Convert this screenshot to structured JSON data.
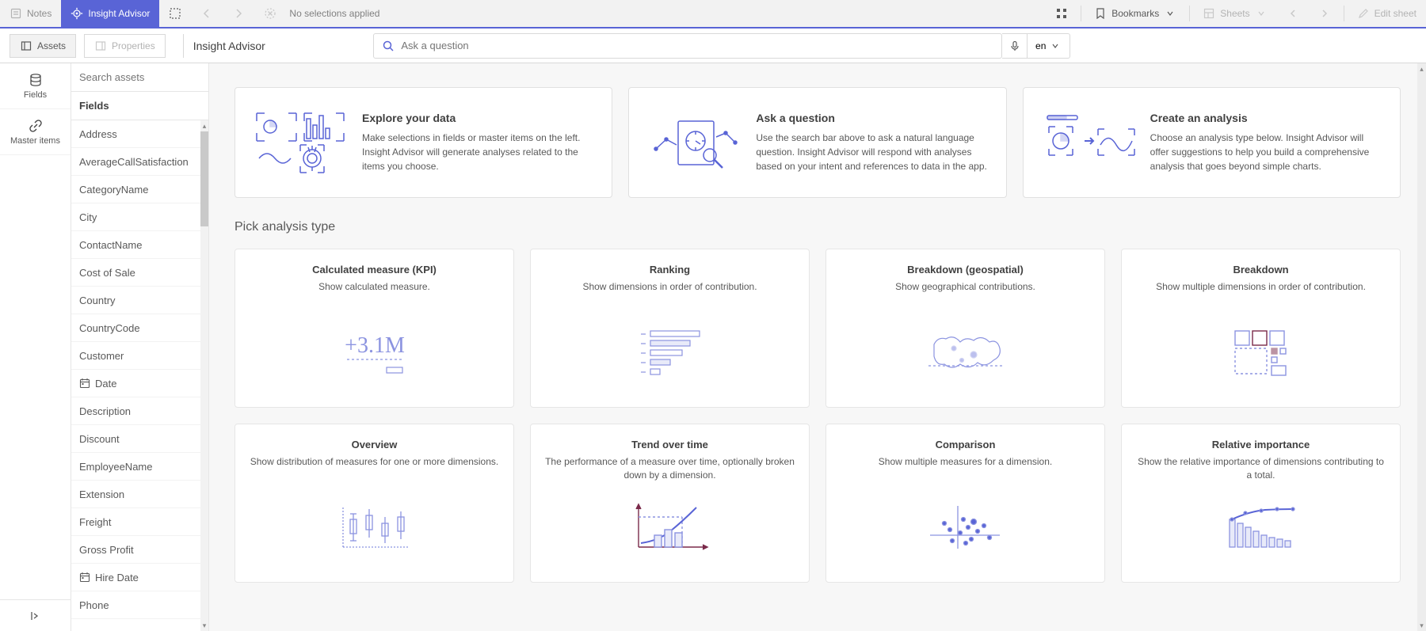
{
  "topbar": {
    "notes": "Notes",
    "insight": "Insight Advisor",
    "no_selections": "No selections applied",
    "bookmarks": "Bookmarks",
    "sheets": "Sheets",
    "edit_sheet": "Edit sheet"
  },
  "secondbar": {
    "assets": "Assets",
    "properties": "Properties",
    "title": "Insight Advisor",
    "search_placeholder": "Ask a question",
    "lang": "en"
  },
  "rail": {
    "fields": "Fields",
    "master_items": "Master items"
  },
  "sidepanel": {
    "search_placeholder": "Search assets",
    "header": "Fields",
    "fields": [
      {
        "label": "Address"
      },
      {
        "label": "AverageCallSatisfaction"
      },
      {
        "label": "CategoryName"
      },
      {
        "label": "City"
      },
      {
        "label": "ContactName"
      },
      {
        "label": "Cost of Sale"
      },
      {
        "label": "Country"
      },
      {
        "label": "CountryCode"
      },
      {
        "label": "Customer"
      },
      {
        "label": "Date",
        "icon": "date"
      },
      {
        "label": "Description"
      },
      {
        "label": "Discount"
      },
      {
        "label": "EmployeeName"
      },
      {
        "label": "Extension"
      },
      {
        "label": "Freight"
      },
      {
        "label": "Gross Profit"
      },
      {
        "label": "Hire Date",
        "icon": "date"
      },
      {
        "label": "Phone"
      }
    ]
  },
  "promos": [
    {
      "title": "Explore your data",
      "desc": "Make selections in fields or master items on the left. Insight Advisor will generate analyses related to the items you choose."
    },
    {
      "title": "Ask a question",
      "desc": "Use the search bar above to ask a natural language question. Insight Advisor will respond with analyses based on your intent and references to data in the app."
    },
    {
      "title": "Create an analysis",
      "desc": "Choose an analysis type below. Insight Advisor will offer suggestions to help you build a comprehensive analysis that goes beyond simple charts."
    }
  ],
  "section_title": "Pick analysis type",
  "analyses": [
    {
      "title": "Calculated measure (KPI)",
      "desc": "Show calculated measure."
    },
    {
      "title": "Ranking",
      "desc": "Show dimensions in order of contribution."
    },
    {
      "title": "Breakdown (geospatial)",
      "desc": "Show geographical contributions."
    },
    {
      "title": "Breakdown",
      "desc": "Show multiple dimensions in order of contribution."
    },
    {
      "title": "Overview",
      "desc": "Show distribution of measures for one or more dimensions."
    },
    {
      "title": "Trend over time",
      "desc": "The performance of a measure over time, optionally broken down by a dimension."
    },
    {
      "title": "Comparison",
      "desc": "Show multiple measures for a dimension."
    },
    {
      "title": "Relative importance",
      "desc": "Show the relative importance of dimensions contributing to a total."
    }
  ]
}
